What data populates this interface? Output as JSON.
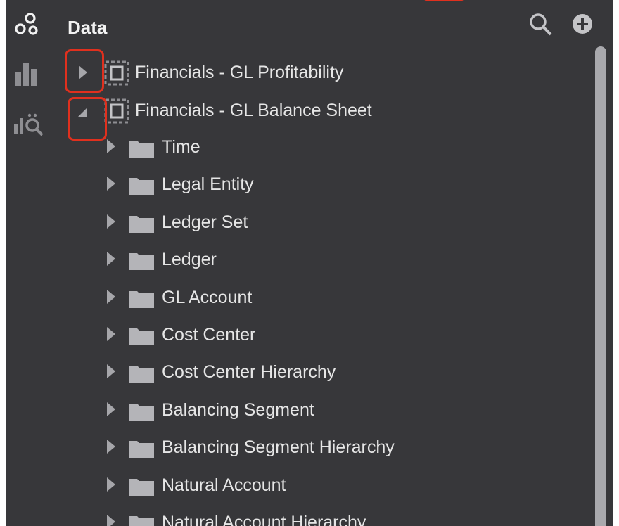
{
  "header": {
    "title": "Data"
  },
  "rail": {
    "icons": [
      "datasets-icon",
      "visualize-icon",
      "analytics-icon"
    ]
  },
  "actions": {
    "icons": [
      "search-icon",
      "add-icon"
    ]
  },
  "tree": {
    "roots": [
      {
        "label": "Financials - GL Profitability",
        "expanded": false
      },
      {
        "label": "Financials - GL Balance Sheet",
        "expanded": true
      }
    ],
    "children": [
      {
        "label": "Time"
      },
      {
        "label": "Legal Entity"
      },
      {
        "label": "Ledger Set"
      },
      {
        "label": "Ledger"
      },
      {
        "label": "GL Account"
      },
      {
        "label": "Cost Center"
      },
      {
        "label": "Cost Center Hierarchy"
      },
      {
        "label": "Balancing Segment"
      },
      {
        "label": "Balancing Segment Hierarchy"
      },
      {
        "label": "Natural Account"
      },
      {
        "label": "Natural Account Hierarchy"
      }
    ]
  },
  "colors": {
    "panel_background": "#37373a",
    "text": "#e6e6e6",
    "icon": "#b9b9bc",
    "highlight": "#e0301e",
    "scrollbar": "#a9a9ad"
  }
}
